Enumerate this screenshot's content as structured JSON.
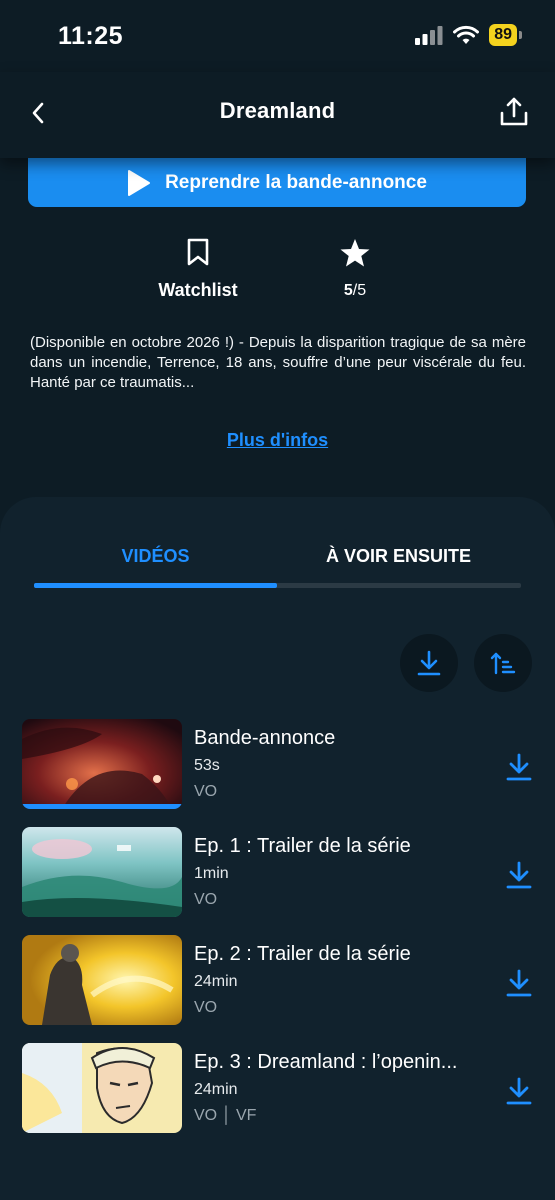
{
  "status_bar": {
    "time": "11:25",
    "battery": "89"
  },
  "nav": {
    "title": "Dreamland"
  },
  "resume_button": {
    "label": "Reprendre la bande-annonce"
  },
  "actions": {
    "watchlist_label": "Watchlist",
    "rating_value": "5",
    "rating_max": "/5"
  },
  "synopsis": "(Disponible en octobre 2026 !) - Depuis la disparition tragique de sa mère dans un incendie, Terrence, 18 ans, souffre d’une peur viscérale du feu. Hanté par ce traumatis...",
  "more_info": "Plus d'infos",
  "tabs": [
    {
      "label": "VIDÉOS",
      "active": true
    },
    {
      "label": "À VOIR ENSUITE",
      "active": false
    }
  ],
  "videos": [
    {
      "title": "Bande-annonce",
      "duration": "53s",
      "lang": "VO",
      "progress": 1.0
    },
    {
      "title": "Ep. 1 : Trailer de la série",
      "duration": "1min",
      "lang": "VO"
    },
    {
      "title": "Ep. 2 : Trailer de la série",
      "duration": "24min",
      "lang": "VO"
    },
    {
      "title": "Ep. 3 : Dreamland : l’openin...",
      "duration": "24min",
      "lang": "VO │ VF"
    }
  ],
  "colors": {
    "background": "#0d1c25",
    "panel": "#11222d",
    "accent": "#1f8fff",
    "resume_button": "#1a8df0",
    "battery": "#f4d21e"
  },
  "icons": [
    "back-chevron-icon",
    "share-icon",
    "play-icon",
    "bookmark-icon",
    "star-icon",
    "download-icon",
    "sort-icon"
  ]
}
